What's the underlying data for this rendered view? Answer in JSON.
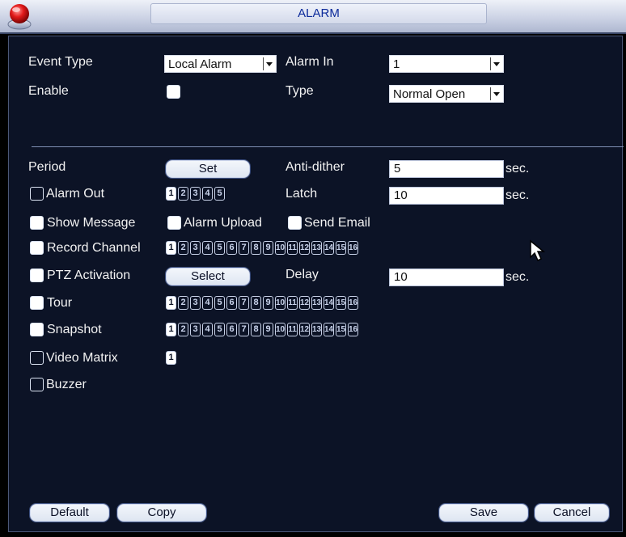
{
  "window": {
    "title": "ALARM"
  },
  "form": {
    "event_type": {
      "label": "Event Type",
      "value": "Local Alarm"
    },
    "alarm_in": {
      "label": "Alarm In",
      "value": "1"
    },
    "enable": {
      "label": "Enable",
      "checked": false
    },
    "type": {
      "label": "Type",
      "value": "Normal Open"
    },
    "period": {
      "label": "Period",
      "button": "Set"
    },
    "anti_dither": {
      "label": "Anti-dither",
      "value": "5",
      "unit": "sec."
    },
    "alarm_out": {
      "label": "Alarm Out",
      "checked": false,
      "numbers": [
        "1",
        "2",
        "3",
        "4",
        "5"
      ],
      "selected": [
        "1"
      ]
    },
    "latch": {
      "label": "Latch",
      "value": "10",
      "unit": "sec."
    },
    "show_message": {
      "label": "Show Message",
      "checked": true
    },
    "alarm_upload": {
      "label": "Alarm Upload",
      "checked": true
    },
    "send_email": {
      "label": "Send Email",
      "checked": true
    },
    "record_channel": {
      "label": "Record Channel",
      "checked": true,
      "numbers": [
        "1",
        "2",
        "3",
        "4",
        "5",
        "6",
        "7",
        "8",
        "9",
        "10",
        "11",
        "12",
        "13",
        "14",
        "15",
        "16"
      ],
      "selected": [
        "1"
      ]
    },
    "ptz_activation": {
      "label": "PTZ Activation",
      "checked": true,
      "button": "Select"
    },
    "delay": {
      "label": "Delay",
      "value": "10",
      "unit": "sec."
    },
    "tour": {
      "label": "Tour",
      "checked": true,
      "numbers": [
        "1",
        "2",
        "3",
        "4",
        "5",
        "6",
        "7",
        "8",
        "9",
        "10",
        "11",
        "12",
        "13",
        "14",
        "15",
        "16"
      ],
      "selected": [
        "1"
      ]
    },
    "snapshot": {
      "label": "Snapshot",
      "checked": true,
      "numbers": [
        "1",
        "2",
        "3",
        "4",
        "5",
        "6",
        "7",
        "8",
        "9",
        "10",
        "11",
        "12",
        "13",
        "14",
        "15",
        "16"
      ],
      "selected": [
        "1"
      ]
    },
    "video_matrix": {
      "label": "Video Matrix",
      "checked": false,
      "numbers": [
        "1"
      ],
      "selected": [
        "1"
      ]
    },
    "buzzer": {
      "label": "Buzzer",
      "checked": false
    }
  },
  "buttons": {
    "default": "Default",
    "copy": "Copy",
    "save": "Save",
    "cancel": "Cancel"
  },
  "colors": {
    "panel": "#0c1326",
    "accent": "#0c2a9a"
  },
  "icons": {
    "logo": "red-orb-logo-icon",
    "cursor": "mouse-pointer-icon"
  }
}
